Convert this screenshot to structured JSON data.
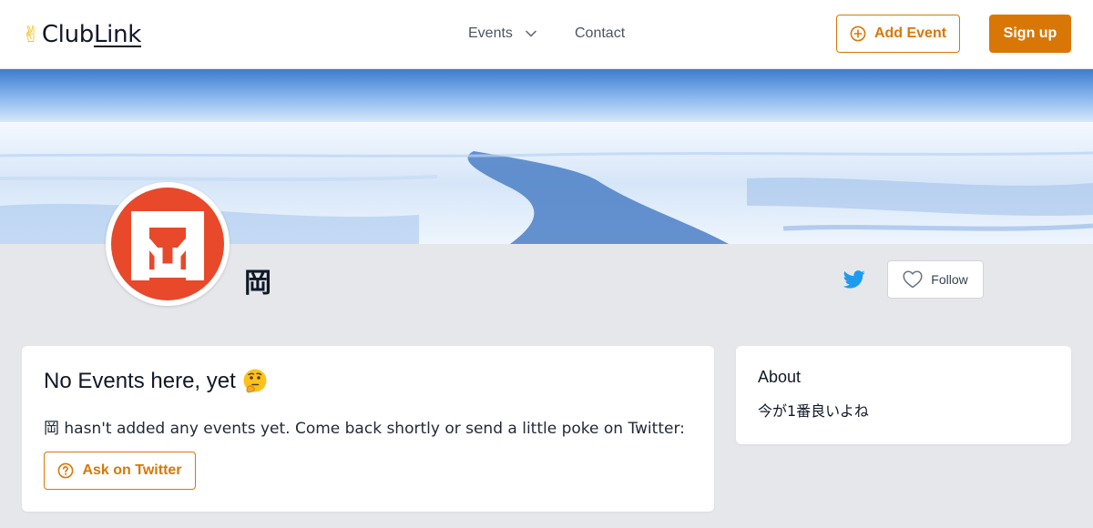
{
  "header": {
    "logo_text_a": "Club",
    "logo_text_b": "Link",
    "logo_icon": "victory-hand-icon",
    "nav_events_label": "Events",
    "nav_contact_label": "Contact",
    "add_event_label": "Add Event",
    "signup_label": "Sign up"
  },
  "profile": {
    "name": "岡",
    "avatar_icon": "red-kanji-seal-logo",
    "follow_label": "Follow",
    "twitter_icon": "twitter-icon"
  },
  "events_card": {
    "heading": "No Events here, yet",
    "heading_emoji": "thinking-face-icon",
    "message": "岡 hasn't added any events yet. Come back shortly or send a little poke on Twitter:",
    "ask_label": "Ask on Twitter"
  },
  "about_card": {
    "title": "About",
    "text": "今が1番良いよね"
  },
  "colors": {
    "accent": "#d97706",
    "page_bg": "#e5e7eb",
    "twitter_blue": "#1d9bf0",
    "seal_red": "#e8492a"
  }
}
